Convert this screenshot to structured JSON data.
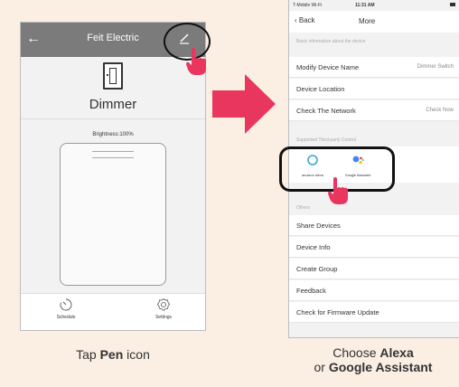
{
  "phone1": {
    "header_title": "Feit Electric",
    "back_glyph": "←",
    "device_name": "Dimmer",
    "brightness_label": "Brightness:100%",
    "brightness_level": 1.0,
    "tabs": [
      {
        "label": "Schedule",
        "icon": "timer-icon"
      },
      {
        "label": "Settings",
        "icon": "gear-icon"
      }
    ],
    "header_color": "#7b7b7b"
  },
  "phone2": {
    "status": {
      "carrier": "T-Mobile Wi-Fi",
      "time": "11:31 AM"
    },
    "nav": {
      "back_label": "Back",
      "title": "More"
    },
    "sections": {
      "basic": "Basic information about the device",
      "third_party": "Supported Third-party Control",
      "others": "Others"
    },
    "basic_rows": [
      {
        "label": "Modify Device Name",
        "value": "Dimmer  Switch"
      },
      {
        "label": "Device Location",
        "value": ""
      },
      {
        "label": "Check The Network",
        "value": "Check Now"
      }
    ],
    "third_party": [
      {
        "label": "amazon alexa",
        "icon": "alexa-icon"
      },
      {
        "label": "Google Assistant",
        "icon": "google-assistant-icon"
      }
    ],
    "other_rows": [
      {
        "label": "Share Devices"
      },
      {
        "label": "Device Info"
      },
      {
        "label": "Create Group"
      },
      {
        "label": "Feedback"
      },
      {
        "label": "Check for Firmware Update"
      }
    ]
  },
  "captions": {
    "left_pre": "Tap ",
    "left_bold": "Pen",
    "left_post": " icon",
    "right_line1_pre": "Choose ",
    "right_line1_bold": "Alexa",
    "right_line2_pre": "or ",
    "right_line2_bold": "Google Assistant"
  },
  "colors": {
    "accent_pink": "#e8365f",
    "background": "#fbeee3"
  }
}
